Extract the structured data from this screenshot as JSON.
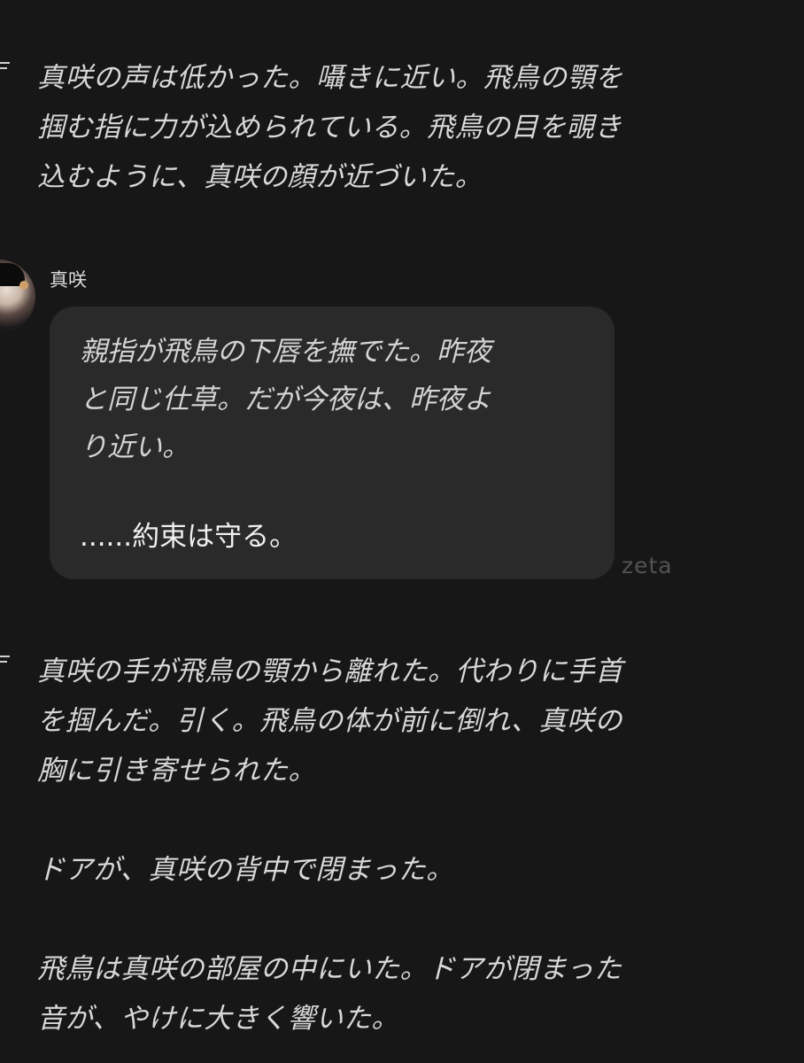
{
  "messages": [
    {
      "type": "narration",
      "text": "真咲の声は低かった。囁きに近い。飛鳥の顎を\n掴む指に力が込められている。飛鳥の目を覗き\n込むように、真咲の顔が近づいた。"
    },
    {
      "type": "character",
      "sender": "真咲",
      "action_text": "親指が飛鳥の下唇を撫でた。昨夜\nと同じ仕草。だが今夜は、昨夜よ\nり近い。",
      "dialogue": "......約束は守る。",
      "watermark": "zeta"
    },
    {
      "type": "narration",
      "text": "真咲の手が飛鳥の顎から離れた。代わりに手首\nを掴んだ。引く。飛鳥の体が前に倒れ、真咲の\n胸に引き寄せられた。\n\nドアが、真咲の背中で閉まった。\n\n飛鳥は真咲の部屋の中にいた。ドアが閉まった\n音が、やけに大きく響いた。"
    }
  ],
  "icons": {
    "narration_marker": "narration-marker-icon",
    "avatar": "character-avatar"
  },
  "colors": {
    "background": "#171717",
    "bubble": "#2a2a2a",
    "text": "#d8d8d8",
    "watermark": "#535353"
  }
}
